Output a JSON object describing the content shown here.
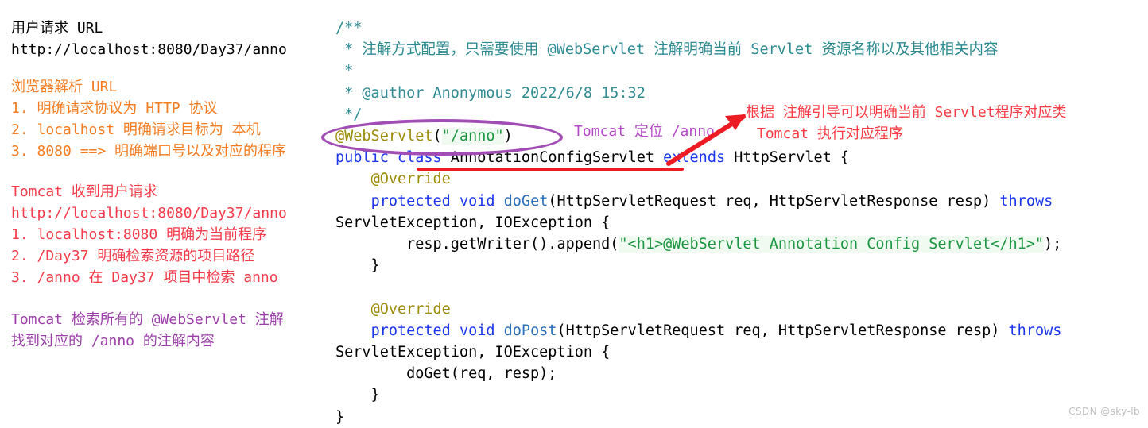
{
  "meta": {
    "background": "#ffffff",
    "watermark": "CSDN @sky-lb"
  },
  "left_notes": {
    "blocks": [
      {
        "name": "user-request-url",
        "lines": [
          {
            "text": "用户请求 URL",
            "color": "#000000"
          },
          {
            "text": "http://localhost:8080/Day37/anno",
            "color": "#000000"
          }
        ]
      },
      {
        "name": "browser-parse-url",
        "lines": [
          {
            "text": "浏览器解析 URL",
            "color": "#F47B20"
          },
          {
            "text": "1. 明确请求协议为 HTTP 协议",
            "color": "#F47B20"
          },
          {
            "text": "2. localhost 明确请求目标为 本机",
            "color": "#F47B20"
          },
          {
            "text": "3. 8080 ==> 明确端口号以及对应的程序",
            "color": "#F47B20"
          }
        ]
      },
      {
        "name": "tomcat-receives-request",
        "lines": [
          {
            "text": "Tomcat 收到用户请求",
            "color": "#F43B4A"
          },
          {
            "text": "http://localhost:8080/Day37/anno",
            "color": "#F43B4A"
          },
          {
            "text": "1. localhost:8080 明确为当前程序",
            "color": "#F43B4A"
          },
          {
            "text": "2. /Day37 明确检索资源的项目路径",
            "color": "#F43B4A"
          },
          {
            "text": "3. /anno 在 Day37 项目中检索 anno",
            "color": "#F43B4A"
          }
        ]
      },
      {
        "name": "tomcat-scans-annotations",
        "lines": [
          {
            "text": "Tomcat 检索所有的 @WebServlet 注解",
            "color": "#9B3FA8"
          },
          {
            "text": "找到对应的 /anno 的注解内容",
            "color": "#9B3FA8"
          }
        ]
      }
    ]
  },
  "code": {
    "language": "java",
    "lines": [
      {
        "segments": [
          {
            "t": "/**",
            "c": "comment"
          }
        ]
      },
      {
        "segments": [
          {
            "t": " * 注解方式配置，只需要使用 @WebServlet 注解明确当前 Servlet 资源名称以及其他相关内容",
            "c": "comment"
          }
        ]
      },
      {
        "segments": [
          {
            "t": " *",
            "c": "comment"
          }
        ]
      },
      {
        "segments": [
          {
            "t": " * @author Anonymous 2022/6/8 15:32",
            "c": "comment"
          }
        ]
      },
      {
        "segments": [
          {
            "t": " */",
            "c": "comment"
          }
        ]
      },
      {
        "segments": [
          {
            "t": "@WebServlet",
            "c": "anno"
          },
          {
            "t": "(",
            "c": "plain"
          },
          {
            "t": "\"/anno\"",
            "c": "string"
          },
          {
            "t": ")",
            "c": "plain"
          }
        ]
      },
      {
        "segments": [
          {
            "t": "public",
            "c": "keyword"
          },
          {
            "t": " ",
            "c": "plain"
          },
          {
            "t": "class",
            "c": "keyword"
          },
          {
            "t": " AnnotationConfigServlet ",
            "c": "plain"
          },
          {
            "t": "extends",
            "c": "keyword"
          },
          {
            "t": " HttpServlet {",
            "c": "plain"
          }
        ]
      },
      {
        "segments": [
          {
            "t": "    ",
            "c": "plain"
          },
          {
            "t": "@Override",
            "c": "anno"
          }
        ]
      },
      {
        "segments": [
          {
            "t": "    ",
            "c": "plain"
          },
          {
            "t": "protected",
            "c": "keyword"
          },
          {
            "t": " ",
            "c": "plain"
          },
          {
            "t": "void",
            "c": "keyword"
          },
          {
            "t": " ",
            "c": "plain"
          },
          {
            "t": "doGet",
            "c": "method"
          },
          {
            "t": "(HttpServletRequest req, HttpServletResponse resp) ",
            "c": "plain"
          },
          {
            "t": "throws",
            "c": "keyword"
          }
        ]
      },
      {
        "segments": [
          {
            "t": "ServletException, IOException {",
            "c": "plain"
          }
        ]
      },
      {
        "segments": [
          {
            "t": "        resp.getWriter().append(",
            "c": "plain"
          },
          {
            "t": "\"<h1>@WebServlet Annotation Config Servlet</h1>\"",
            "c": "string"
          },
          {
            "t": ");",
            "c": "plain"
          }
        ]
      },
      {
        "segments": [
          {
            "t": "    }",
            "c": "plain"
          }
        ]
      },
      {
        "segments": [
          {
            "t": "",
            "c": "plain"
          }
        ]
      },
      {
        "segments": [
          {
            "t": "    ",
            "c": "plain"
          },
          {
            "t": "@Override",
            "c": "anno"
          }
        ]
      },
      {
        "segments": [
          {
            "t": "    ",
            "c": "plain"
          },
          {
            "t": "protected",
            "c": "keyword"
          },
          {
            "t": " ",
            "c": "plain"
          },
          {
            "t": "void",
            "c": "keyword"
          },
          {
            "t": " ",
            "c": "plain"
          },
          {
            "t": "doPost",
            "c": "method"
          },
          {
            "t": "(HttpServletRequest req, HttpServletResponse resp) ",
            "c": "plain"
          },
          {
            "t": "throws",
            "c": "keyword"
          }
        ]
      },
      {
        "segments": [
          {
            "t": "ServletException, IOException {",
            "c": "plain"
          }
        ]
      },
      {
        "segments": [
          {
            "t": "        doGet(req, resp);",
            "c": "plain"
          }
        ]
      },
      {
        "segments": [
          {
            "t": "    }",
            "c": "plain"
          }
        ]
      },
      {
        "segments": [
          {
            "t": "}",
            "c": "plain"
          }
        ]
      }
    ]
  },
  "annotations": {
    "tomcat_locate": "Tomcat 定位 /anno",
    "red_note_line1": "根据 注解引导可以明确当前 Servlet程序对应类",
    "red_note_line2": "Tomcat 执行对应程序"
  },
  "colors": {
    "comment": "#2E8B92",
    "keyword": "#1A35EE",
    "annotation": "#9A8A05",
    "string": "#1A9641",
    "method": "#2A6EBB",
    "orange": "#F47B20",
    "red": "#F43B4A",
    "purple": "#9B3FA8",
    "ellipse": "#A24DB5",
    "arrow_red": "#ED1C24"
  }
}
